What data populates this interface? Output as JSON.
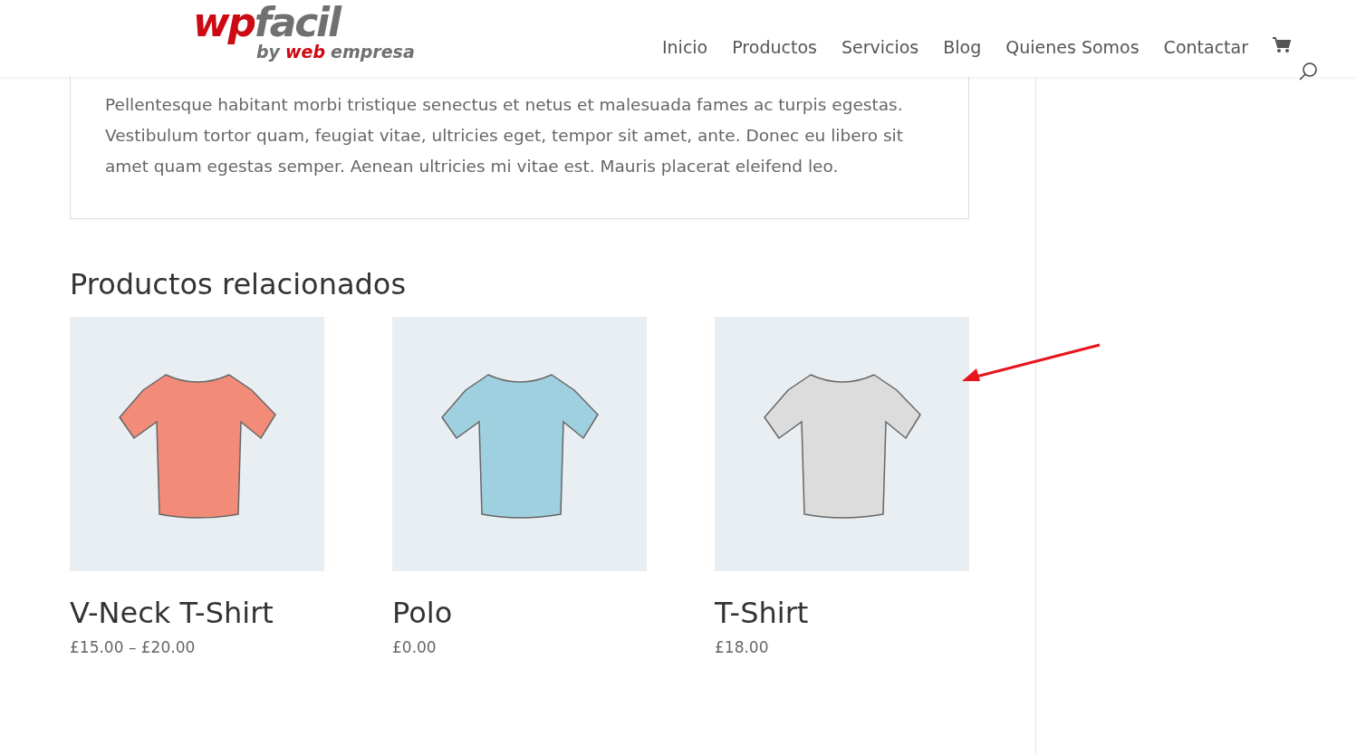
{
  "header": {
    "logo": {
      "main": [
        {
          "text": "wp",
          "kind": "accent"
        },
        {
          "text": "facil",
          "kind": "plain"
        }
      ],
      "sub": [
        {
          "text": "by",
          "kind": "plain"
        },
        {
          "text": "web",
          "kind": "accent"
        },
        {
          "text": "empresa",
          "kind": "plain"
        }
      ]
    },
    "nav": [
      "Inicio",
      "Productos",
      "Servicios",
      "Blog",
      "Quienes Somos",
      "Contactar"
    ]
  },
  "description": "Pellentesque habitant morbi tristique senectus et netus et malesuada fames ac turpis egestas. Vestibulum tortor quam, feugiat vitae, ultricies eget, tempor sit amet, ante. Donec eu libero sit amet quam egestas semper. Aenean ultricies mi vitae est. Mauris placerat eleifend leo.",
  "related": {
    "title": "Productos relacionados",
    "products": [
      {
        "name": "V-Neck T-Shirt",
        "price": "£15.00 – £20.00",
        "color": "#f28b78"
      },
      {
        "name": "Polo",
        "price": "£0.00",
        "color": "#9fd0df"
      },
      {
        "name": "T-Shirt",
        "price": "£18.00",
        "color": "#dcdcdc"
      }
    ]
  }
}
